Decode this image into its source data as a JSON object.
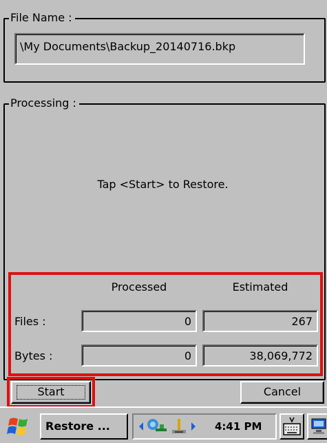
{
  "file_group": {
    "title": "File Name :",
    "path": "\\My Documents\\Backup_20140716.bkp"
  },
  "processing_group": {
    "title": "Processing :",
    "message": "Tap <Start> to Restore."
  },
  "stats": {
    "headers": {
      "processed": "Processed",
      "estimated": "Estimated"
    },
    "files": {
      "label": "Files :",
      "processed": "0",
      "estimated": "267"
    },
    "bytes": {
      "label": "Bytes :",
      "processed": "0",
      "estimated": "38,069,772"
    }
  },
  "buttons": {
    "start": "Start",
    "cancel": "Cancel"
  },
  "taskbar": {
    "start_icon": "windows-flag-icon",
    "active_task": "Restore ...",
    "tray_icons": [
      "arrow-left-icon",
      "network-icon",
      "usb-icon",
      "arrow-right-icon"
    ],
    "clock": "4:41 PM",
    "keyboard_icon": "keyboard-icon",
    "desktop_icon": "desktop-icon"
  },
  "highlight_color": "#e01010"
}
